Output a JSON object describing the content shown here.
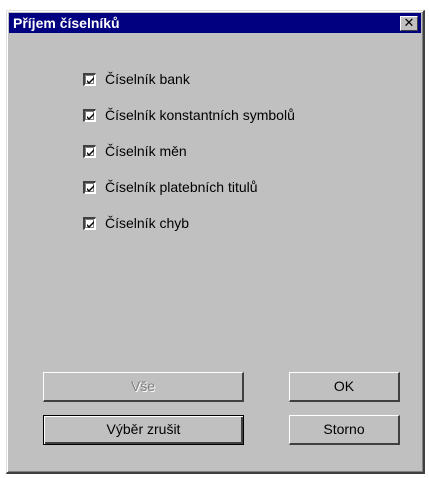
{
  "window": {
    "title": "Příjem číselníků",
    "close_label": "✕"
  },
  "checklist": {
    "items": [
      {
        "label": "Číselník bank",
        "checked": true
      },
      {
        "label": "Číselník konstantních symbolů",
        "checked": true
      },
      {
        "label": "Číselník měn",
        "checked": true
      },
      {
        "label": "Číselník platebních titulů",
        "checked": true
      },
      {
        "label": "Číselník chyb",
        "checked": true
      }
    ]
  },
  "buttons": {
    "all_label": "Vše",
    "all_enabled": false,
    "clear_selection_label": "Výběr zrušit",
    "ok_label": "OK",
    "cancel_label": "Storno"
  },
  "colors": {
    "titlebar": "#000080",
    "dialog_bg": "#c0c0c0"
  },
  "icons": {
    "close": "close-icon",
    "check": "checkmark-icon"
  }
}
